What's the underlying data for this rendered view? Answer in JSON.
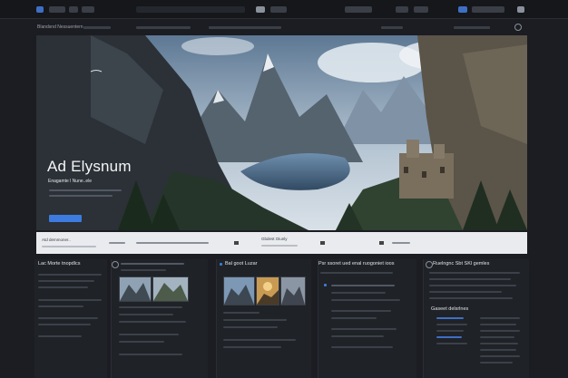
{
  "hero": {
    "title": "Ad Elysnum",
    "subtitle": "Enagamte l Nune..ele"
  },
  "nav": {
    "brand": "Blandsnd Nessuentern"
  },
  "infostrip": {
    "left_label": "Atd demmoner..",
    "mid_label": "Gbdest Oiunly"
  },
  "panels": {
    "col1_title": "Lac Morte tnopdlcs",
    "col3_title": "Bal goot Luzar",
    "col4_title": "Psr ssoret ued enal ruogoniet ioos",
    "col5_title": "Ruelngnc Sbt SKl gemles",
    "col5_sub": "Gaseet delsrlnes"
  },
  "colors": {
    "accent": "#3f7ad6",
    "background": "#1b1d22",
    "strip": "#e9ebee"
  },
  "icons": [
    "menu-icon",
    "search-icon",
    "circle-icon",
    "play-icon"
  ]
}
